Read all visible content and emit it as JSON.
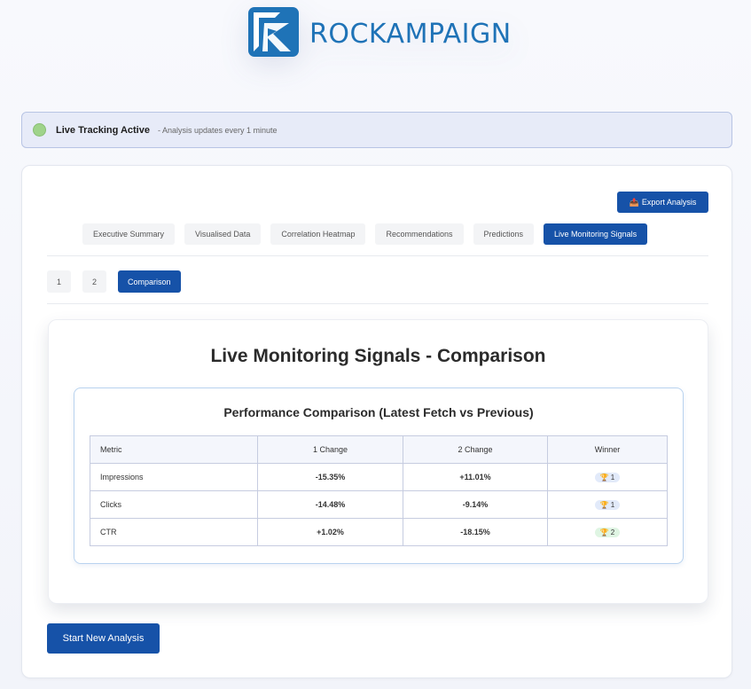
{
  "brand": {
    "name": "ROCKAMPAIGN",
    "color": "#1f73b7"
  },
  "live": {
    "title": "Live Tracking Active",
    "subtitle": "- Analysis updates every 1 minute",
    "status_color": "#9fd38a"
  },
  "toolbar": {
    "export_label": "Export Analysis",
    "export_icon": "📤"
  },
  "tabs": [
    {
      "label": "Executive Summary",
      "active": false
    },
    {
      "label": "Visualised Data",
      "active": false
    },
    {
      "label": "Correlation Heatmap",
      "active": false
    },
    {
      "label": "Recommendations",
      "active": false
    },
    {
      "label": "Predictions",
      "active": false
    },
    {
      "label": "Live Monitoring Signals",
      "active": true
    }
  ],
  "subtabs": [
    {
      "label": "1",
      "active": false
    },
    {
      "label": "2",
      "active": false
    },
    {
      "label": "Comparison",
      "active": true
    }
  ],
  "panel": {
    "title": "Live Monitoring Signals - Comparison",
    "comparison": {
      "title": "Performance Comparison (Latest Fetch vs Previous)",
      "headers": [
        "Metric",
        "1 Change",
        "2 Change",
        "Winner"
      ],
      "rows": [
        {
          "metric": "Impressions",
          "change1": "-15.35%",
          "change1_dir": "neg",
          "change2": "+11.01%",
          "change2_dir": "pos",
          "winner": "1",
          "winner_style": "blue"
        },
        {
          "metric": "Clicks",
          "change1": "-14.48%",
          "change1_dir": "neg",
          "change2": "-9.14%",
          "change2_dir": "neg",
          "winner": "1",
          "winner_style": "blue"
        },
        {
          "metric": "CTR",
          "change1": "+1.02%",
          "change1_dir": "pos",
          "change2": "-18.15%",
          "change2_dir": "neg",
          "winner": "2",
          "winner_style": "green"
        }
      ],
      "trophy_icon": "🏆"
    }
  },
  "actions": {
    "start_new_label": "Start New Analysis"
  },
  "colors": {
    "primary": "#1652a8",
    "negative": "#cc2222",
    "positive": "#1e9a3c"
  }
}
